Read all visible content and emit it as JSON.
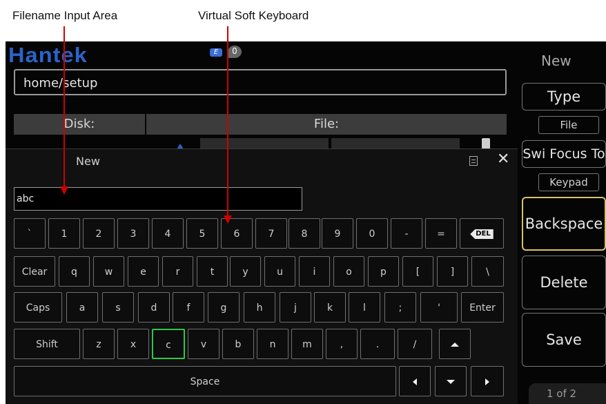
{
  "annotations": {
    "filename_input_area": "Filename Input Area",
    "virtual_soft_keyboard": "Virtual Soft Keyboard"
  },
  "header": {
    "logo": "Hantek",
    "status_icon": "E",
    "status_count": "0"
  },
  "path": "home/setup",
  "file_browser": {
    "disk_header": "Disk:",
    "file_header": "File:"
  },
  "keyboard": {
    "title": "New",
    "close": "✕",
    "input_value": "abc",
    "rows": {
      "row1": [
        "`",
        "1",
        "2",
        "3",
        "4",
        "5",
        "6",
        "7",
        "8",
        "9",
        "0",
        "-",
        "=",
        "DEL"
      ],
      "row2": [
        "Clear",
        "q",
        "w",
        "e",
        "r",
        "t",
        "y",
        "u",
        "i",
        "o",
        "p",
        "[",
        "]",
        "\\"
      ],
      "row3": [
        "Caps",
        "a",
        "s",
        "d",
        "f",
        "g",
        "h",
        "j",
        "k",
        "l",
        ";",
        "'",
        "Enter"
      ],
      "row4": [
        "Shift",
        "z",
        "x",
        "c",
        "v",
        "b",
        "n",
        "m",
        ",",
        ".",
        "/"
      ],
      "space": "Space"
    },
    "selected_key": "c",
    "icons": [
      "list-menu-icon",
      "close-icon",
      "backspace-del-icon",
      "arrow-up-icon",
      "arrow-down-icon",
      "arrow-left-icon",
      "arrow-right-icon"
    ]
  },
  "menu": {
    "title": "New",
    "type_label": "Type",
    "type_value": "File",
    "focus_label": "Swi Focus To",
    "focus_value": "Keypad",
    "backspace": "Backspace",
    "delete": "Delete",
    "save": "Save",
    "page": "1 of 2"
  },
  "colors": {
    "logo": "#2b63c9",
    "annotation_arrow": "#d00000",
    "selected_key_border": "#2fc64a",
    "active_softkey_border": "#d9c36a"
  }
}
